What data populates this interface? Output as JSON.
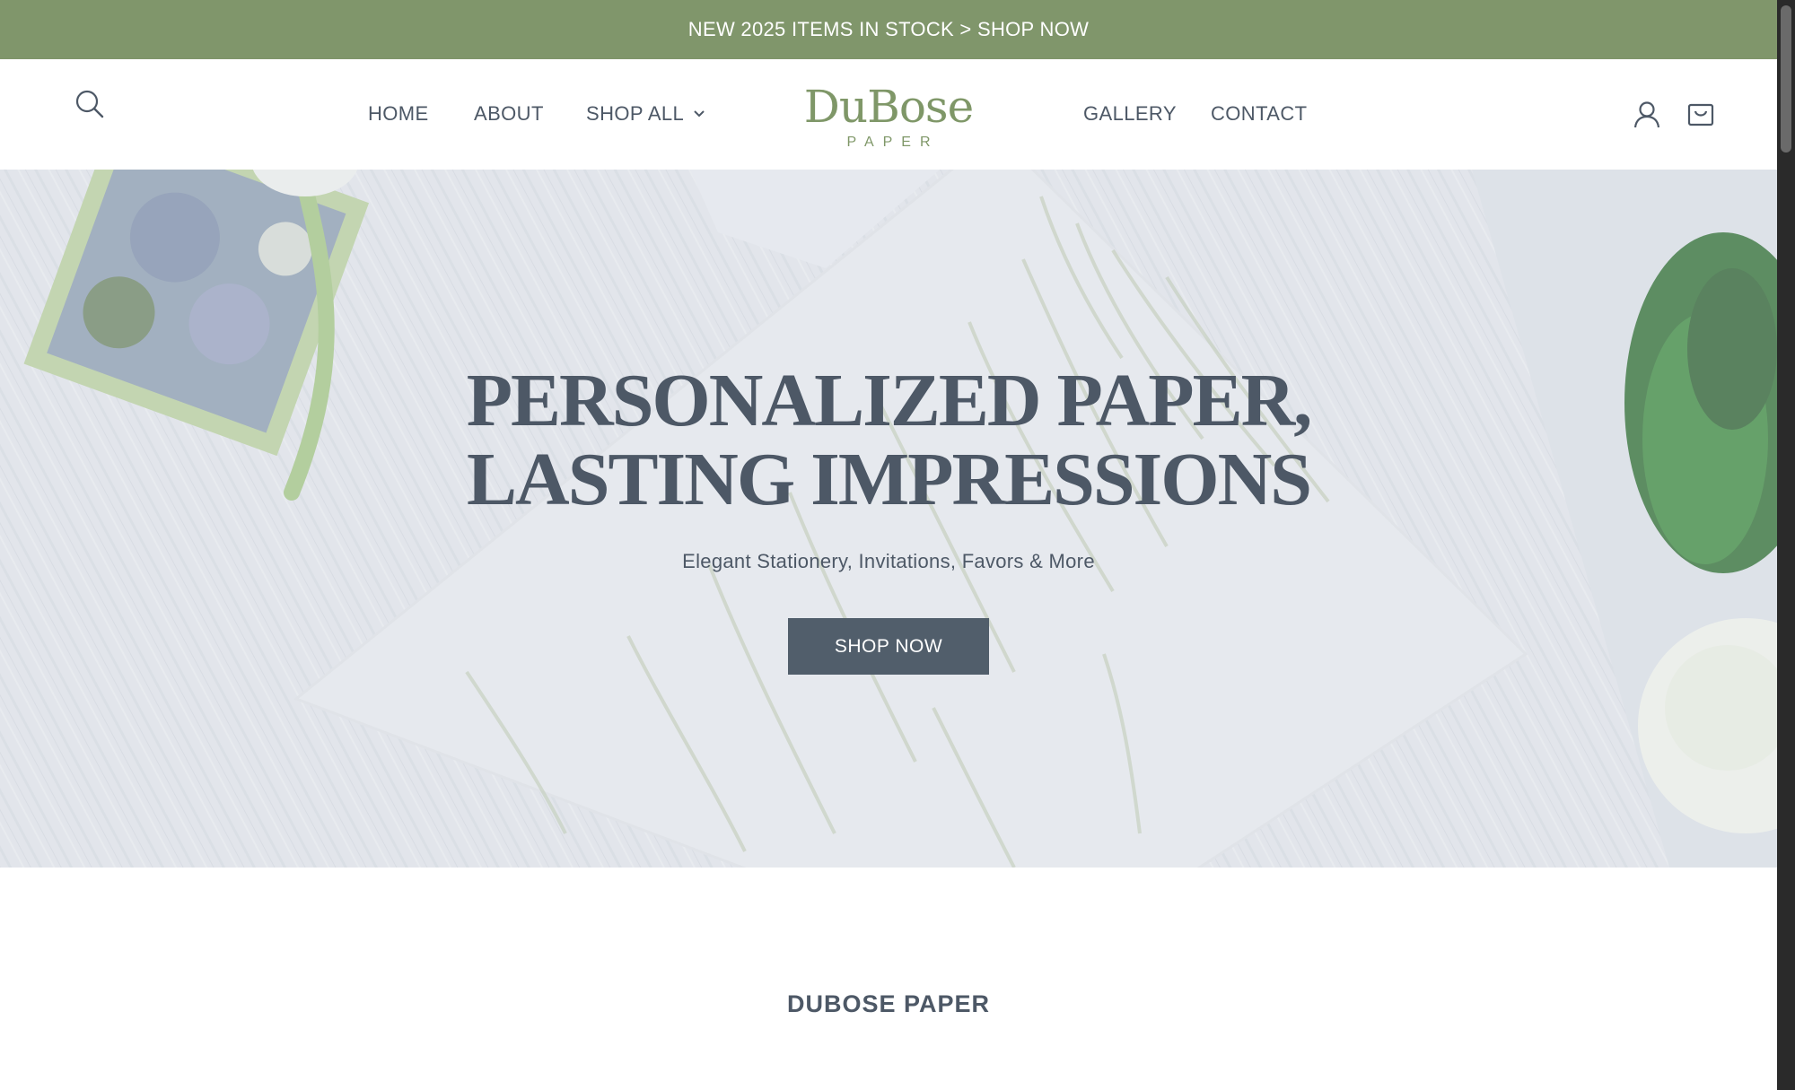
{
  "announcement": {
    "text": "NEW 2025 ITEMS IN STOCK > SHOP NOW"
  },
  "header": {
    "nav_left": [
      {
        "label": "HOME"
      },
      {
        "label": "ABOUT"
      },
      {
        "label": "SHOP ALL",
        "has_dropdown": true
      }
    ],
    "nav_right": [
      {
        "label": "GALLERY"
      },
      {
        "label": "CONTACT"
      }
    ],
    "logo": {
      "wordmark": "DuBose",
      "subtitle": "PAPER"
    },
    "icons": [
      "search-icon",
      "account-icon",
      "cart-icon",
      "chevron-down-icon"
    ]
  },
  "hero": {
    "title": "PERSONALIZED PAPER, LASTING IMPRESSIONS",
    "subtitle": "Elegant Stationery, Invitations, Favors & More",
    "cta_label": "SHOP NOW"
  },
  "section": {
    "title": "DUBOSE PAPER"
  },
  "colors": {
    "announcement_bg": "#80966b",
    "brand_green": "#7f9768",
    "text": "#4d5866",
    "button_bg": "#515e6b"
  }
}
